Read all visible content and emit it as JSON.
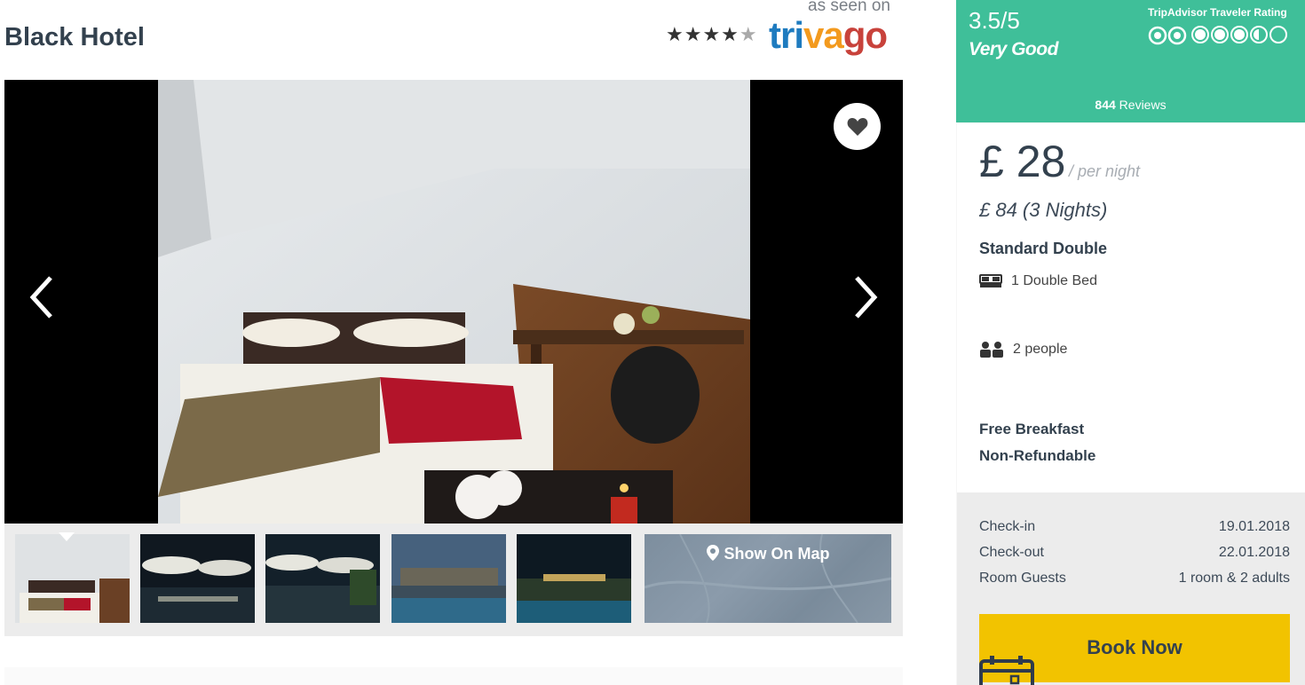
{
  "hotel": {
    "name": "Black Hotel",
    "stars": 4,
    "as_seen_on": "as seen on",
    "partner": "trivago"
  },
  "gallery": {
    "show_on_map": "Show On Map"
  },
  "rating": {
    "score": "3.5/5",
    "label": "Very Good",
    "provider": "TripAdvisor Traveler Rating",
    "bubbles": 3.5,
    "reviews_count": "844",
    "reviews_word": "Reviews"
  },
  "price": {
    "nightly": "£ 28",
    "per_night": "/ per night",
    "total": "£ 84 (3 Nights)",
    "room_type": "Standard Double",
    "bed": "1 Double Bed",
    "people": "2 people",
    "perks": [
      "Free Breakfast",
      "Non-Refundable"
    ]
  },
  "details": {
    "checkin_label": "Check-in",
    "checkin_value": "19.01.2018",
    "checkout_label": "Check-out",
    "checkout_value": "22.01.2018",
    "guests_label": "Room Guests",
    "guests_value": "1 room & 2 adults"
  },
  "actions": {
    "book_now": "Book Now"
  },
  "colors": {
    "rating_green": "#3fbf99",
    "book_yellow": "#f2c300",
    "title_navy": "#33414e"
  }
}
